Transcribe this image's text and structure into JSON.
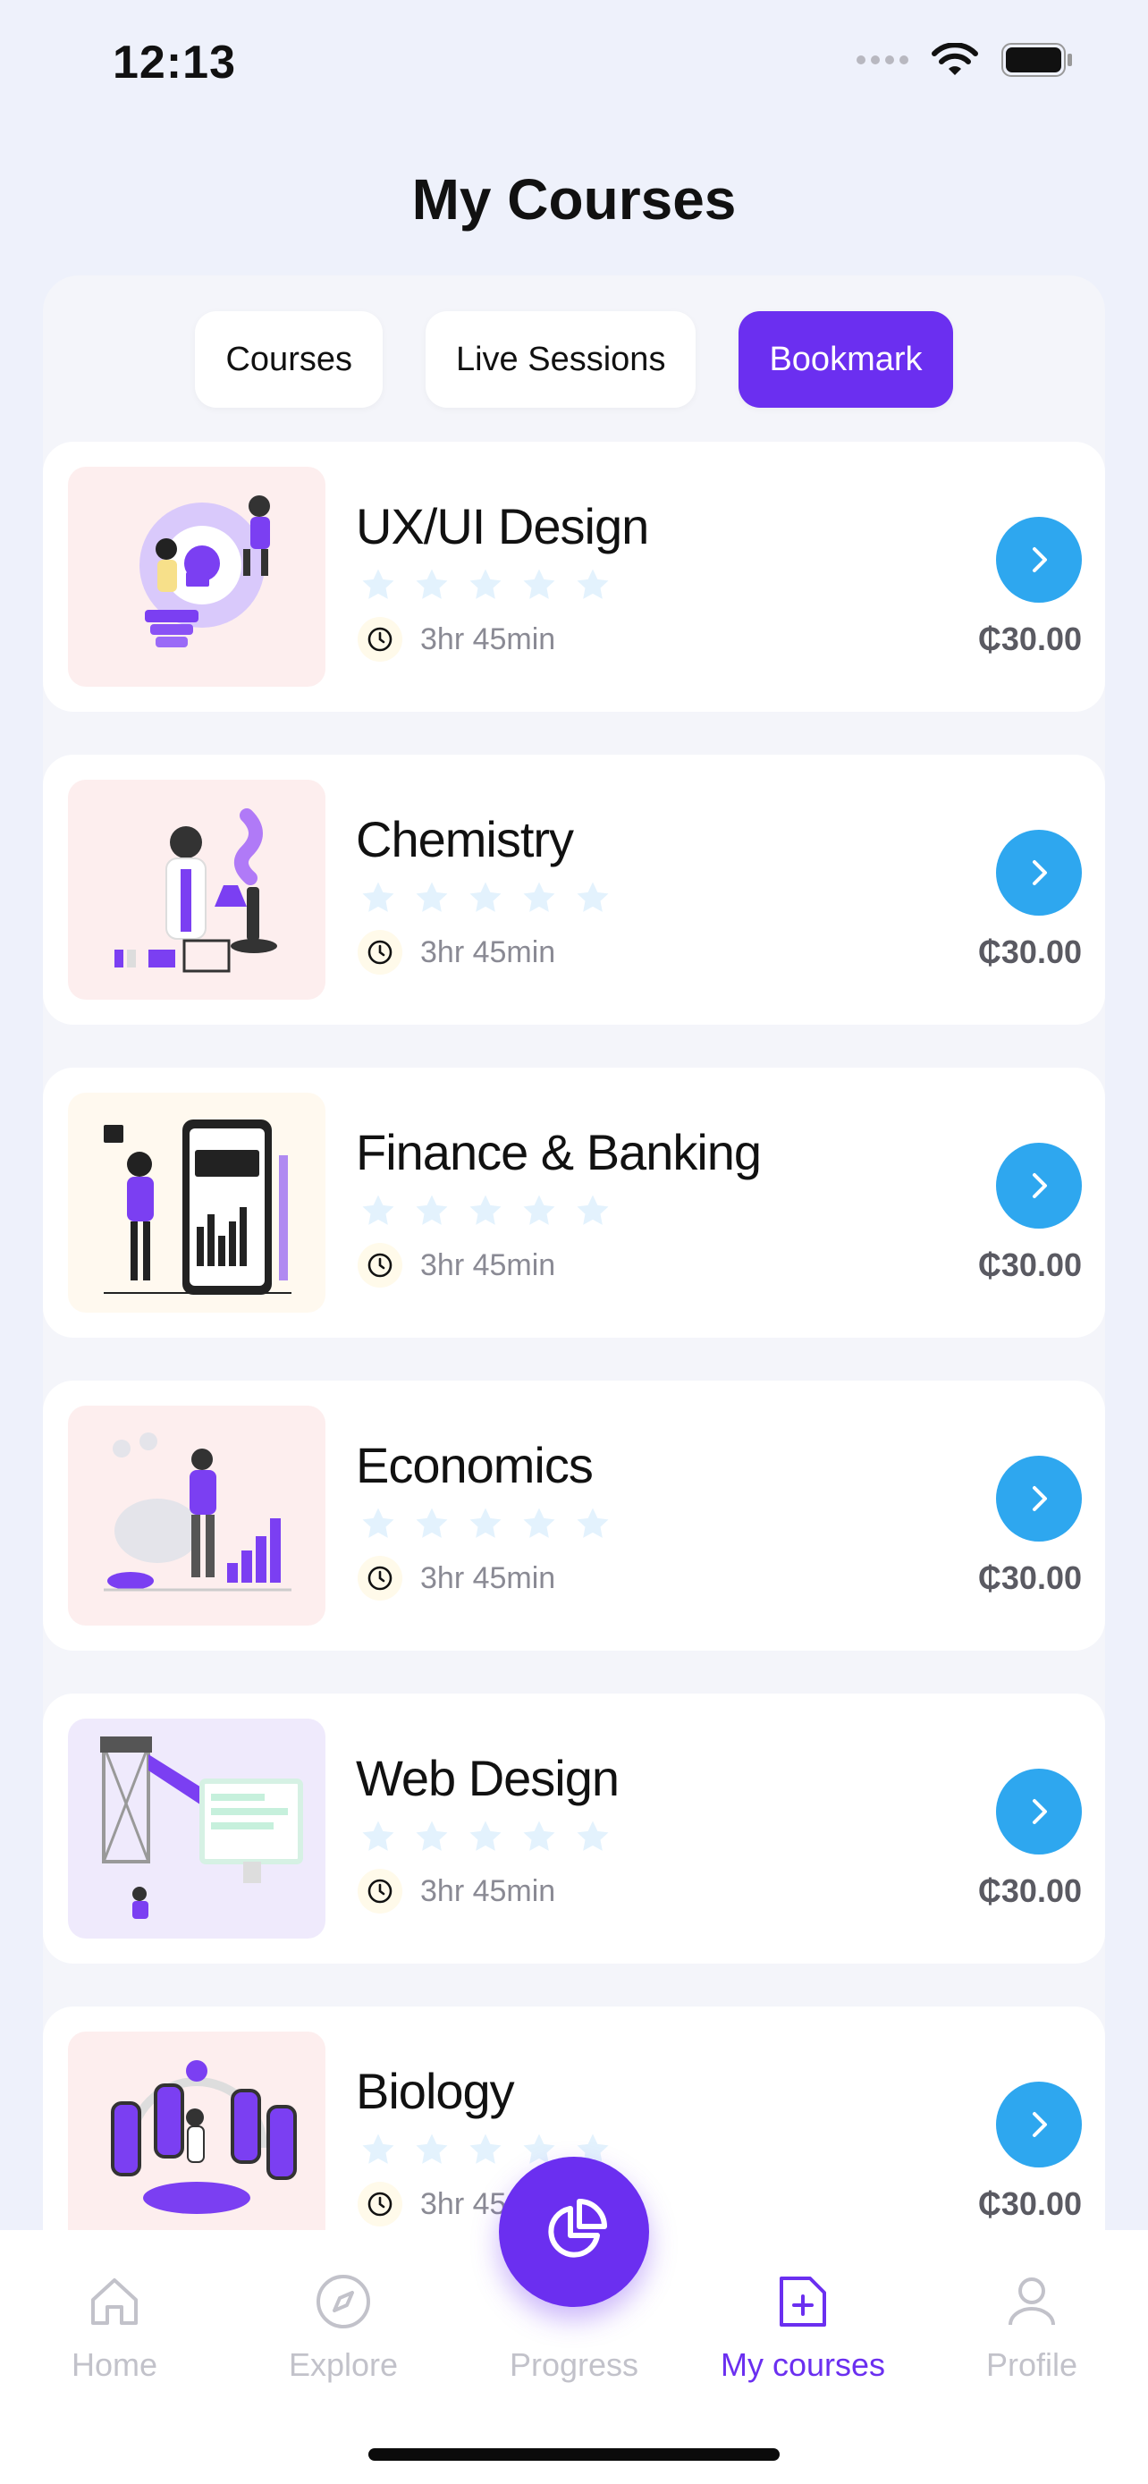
{
  "status": {
    "time": "12:13"
  },
  "page": {
    "title": "My Courses"
  },
  "tabs": [
    {
      "label": "Courses",
      "active": false
    },
    {
      "label": "Live Sessions",
      "active": false
    },
    {
      "label": "Bookmark",
      "active": true
    }
  ],
  "courses": [
    {
      "title": "UX/UI Design",
      "duration": "3hr 45min",
      "price": "₵30.00",
      "rating": 0
    },
    {
      "title": "Chemistry",
      "duration": "3hr 45min",
      "price": "₵30.00",
      "rating": 0
    },
    {
      "title": "Finance & Banking",
      "duration": "3hr 45min",
      "price": "₵30.00",
      "rating": 0
    },
    {
      "title": "Economics",
      "duration": "3hr 45min",
      "price": "₵30.00",
      "rating": 0
    },
    {
      "title": "Web Design",
      "duration": "3hr 45min",
      "price": "₵30.00",
      "rating": 0
    },
    {
      "title": "Biology",
      "duration": "3hr 45min",
      "price": "₵30.00",
      "rating": 0
    }
  ],
  "nav": {
    "items": [
      {
        "label": "Home",
        "icon": "home-icon"
      },
      {
        "label": "Explore",
        "icon": "compass-icon"
      },
      {
        "label": "Progress",
        "icon": "pie-chart-icon"
      },
      {
        "label": "My courses",
        "icon": "document-plus-icon",
        "active": true
      },
      {
        "label": "Profile",
        "icon": "user-icon"
      }
    ]
  },
  "colors": {
    "accent": "#6b2ff0",
    "action": "#2ea7ef",
    "star": "#e3f2fd"
  }
}
